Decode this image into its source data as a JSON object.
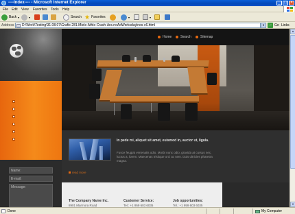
{
  "window": {
    "title": "----Index---- - Microsoft Internet Explorer",
    "controls": [
      "_",
      "□",
      "×"
    ]
  },
  "menu": [
    "File",
    "Edit",
    "View",
    "Favorites",
    "Tools",
    "Help"
  ],
  "toolbar": {
    "back": "Back",
    "search": "Search",
    "favorites": "Favorites"
  },
  "address": {
    "label": "Address",
    "url": "D:\\Work\\Testing\\31.08.07\\Grafix-281.Miele-Athle-Crash-Ara-noAdWorksdaylnes-c6.html",
    "go": "Go",
    "links": "Links"
  },
  "site": {
    "nav": [
      "Home",
      "Search",
      "Sitemap"
    ],
    "form": {
      "name_placeholder": "Name:",
      "email_placeholder": "E-mail:",
      "message_placeholder": "Message:"
    },
    "article": {
      "title": "In pede mi, aliquet sit amet, euismod in, auctor ut, ligula.",
      "body": "Fusce feugiat venenatis odio. Morbi nunc odio, gravida at cursus nec, luctus a, lorem. Maecenas tristique orci ac sem. Duis ultricies pharetra magna.",
      "more": "read more"
    },
    "footer": [
      {
        "heading": "The Company Name Inc.",
        "text": "8901 Marmora Road"
      },
      {
        "heading": "Customer Service:",
        "text": "Tel.: +1 959 603 6035"
      },
      {
        "heading": "Job opportunities:",
        "text": "Tel.: +1 959 603 6035"
      }
    ]
  },
  "status": {
    "text": "Done",
    "zone": "My Computer"
  },
  "colors": {
    "accent_orange": "#f07a14",
    "xp_blue": "#0a5fd8"
  }
}
